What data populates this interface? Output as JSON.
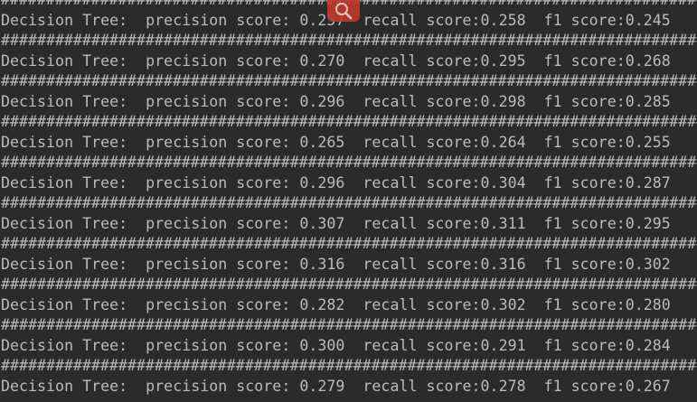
{
  "console": {
    "separator": "################################################################################",
    "results": [
      "Decision Tree:  precision score: 0.257  recall score:0.258  f1 score:0.245",
      "Decision Tree:  precision score: 0.270  recall score:0.295  f1 score:0.268",
      "Decision Tree:  precision score: 0.296  recall score:0.298  f1 score:0.285",
      "Decision Tree:  precision score: 0.265  recall score:0.264  f1 score:0.255",
      "Decision Tree:  precision score: 0.296  recall score:0.304  f1 score:0.287",
      "Decision Tree:  precision score: 0.307  recall score:0.311  f1 score:0.295",
      "Decision Tree:  precision score: 0.316  recall score:0.316  f1 score:0.302",
      "Decision Tree:  precision score: 0.282  recall score:0.302  f1 score:0.280",
      "Decision Tree:  precision score: 0.300  recall score:0.291  f1 score:0.284",
      "Decision Tree:  precision score: 0.279  recall score:0.278  f1 score:0.267"
    ]
  },
  "overlay": {
    "icon": "magnifier-icon",
    "color": "#c0392b"
  }
}
